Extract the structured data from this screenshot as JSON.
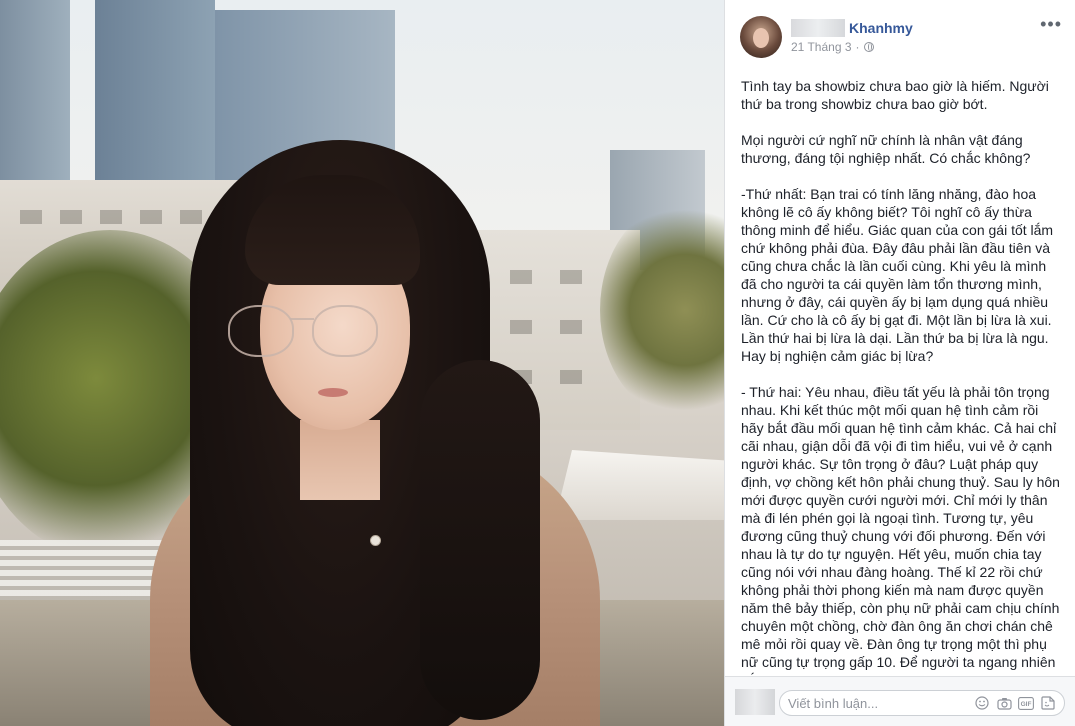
{
  "post": {
    "author": "Khanhmy",
    "date": "21 Tháng 3",
    "separator": "·",
    "more_label": "•••",
    "paragraphs": [
      "Tình tay ba showbiz chưa bao giờ là hiếm. Người thứ ba trong showbiz chưa bao giờ bớt.",
      "Mọi người cứ nghĩ nữ chính là nhân vật đáng thương, đáng tội nghiệp nhất. Có chắc không?",
      "-Thứ nhất: Bạn trai có tính lăng nhăng, đào hoa không lẽ cô ấy không biết? Tôi nghĩ cô ấy thừa thông minh để hiểu. Giác quan của con gái tốt lắm chứ không phải đùa. Đây đâu phải lần đầu tiên và cũng chưa chắc là lần cuối cùng. Khi yêu là mình đã cho người ta cái quyền làm tổn thương mình, nhưng ở đây, cái quyền ấy bị lạm dụng quá nhiều lần. Cứ cho là cô ấy bị gạt đi. Một lần bị lừa là xui. Lần thứ hai bị lừa là dại. Lần thứ ba bị lừa là ngu. Hay bị nghiện cảm giác bị lừa?",
      "- Thứ hai: Yêu nhau, điều tất yếu là phải tôn trọng nhau. Khi kết thúc một mối quan hệ tình cảm rồi hãy bắt đầu mối quan hệ tình cảm khác. Cả hai chỉ cãi nhau, giận dỗi đã vội đi tìm hiểu, vui vẻ ở cạnh người khác. Sự tôn trọng ở đâu? Luật pháp quy định, vợ chồng kết hôn phải chung thuỷ. Sau ly hôn mới được quyền cưới người mới. Chỉ mới ly thân mà đi lén phén gọi là ngoại tình. Tương tự, yêu đương cũng thuỷ chung với đối phương. Đến với nhau là tự do tự nguyện. Hết yêu, muốn chia tay cũng nói với nhau đàng hoàng. Thế kỉ 22 rồi chứ không phải thời phong kiến mà nam được quyền năm thê bảy thiếp, còn phụ nữ phải cam chịu chính chuyên một chồng, chờ đàn ông ăn chơi chán chê mê mỏi rồi quay về. Đàn ông tự trọng một thì phụ nữ cũng tự trọng gấp 10. Để người ta ngang nhiên cắm sừng"
    ]
  },
  "comment": {
    "placeholder": "Viết bình luận...",
    "icons": [
      "emoji-icon",
      "camera-icon",
      "gif-icon",
      "sticker-icon"
    ],
    "gif_label": "GIF"
  },
  "colors": {
    "author_link": "#365899",
    "meta_gray": "#90949c",
    "text": "#1d2129"
  }
}
